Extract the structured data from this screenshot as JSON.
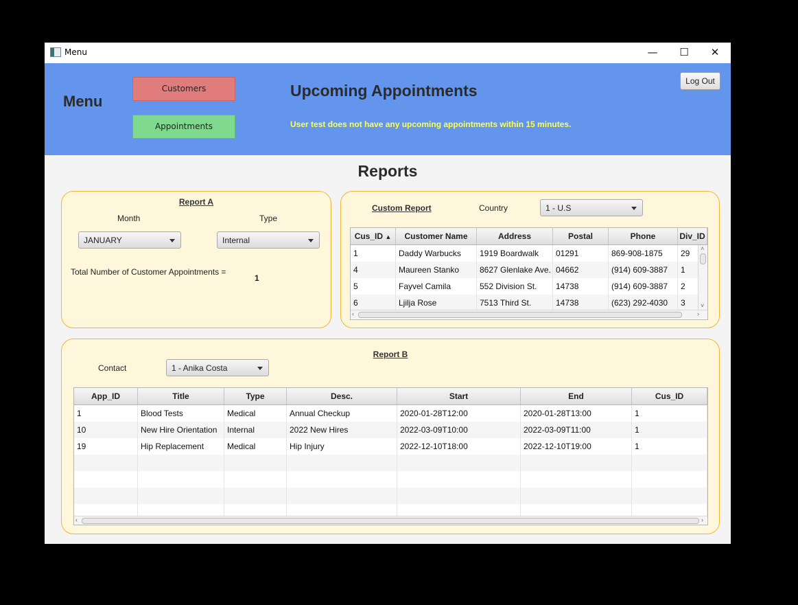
{
  "window": {
    "title": "Menu",
    "controls": {
      "minimize": "—",
      "maximize": "☐",
      "close": "✕"
    }
  },
  "header": {
    "menu_title": "Menu",
    "customers_button": "Customers",
    "appointments_button": "Appointments",
    "upcoming_title": "Upcoming Appointments",
    "upcoming_notice": "User test does not have any upcoming appointments within 15 minutes.",
    "logout_button": "Log Out",
    "colors": {
      "header_bg": "#6495ed",
      "customers_btn": "#e17c7c",
      "appointments_btn": "#7fd98f",
      "notice_text": "#ffff4d"
    }
  },
  "reports_title": "Reports",
  "report_a": {
    "title": "Report A",
    "month_label": "Month",
    "month_value": "JANUARY",
    "type_label": "Type",
    "type_value": "Internal",
    "total_label": "Total Number of Customer Appointments =",
    "total_value": "1"
  },
  "custom_report": {
    "title": "Custom Report",
    "country_label": "Country",
    "country_value": "1 - U.S",
    "sort_indicator": "▲",
    "columns": [
      "Cus_ID",
      "Customer Name",
      "Address",
      "Postal",
      "Phone",
      "Div_ID"
    ],
    "rows": [
      [
        "1",
        "Daddy Warbucks",
        "1919 Boardwalk",
        "01291",
        "869-908-1875",
        "29"
      ],
      [
        "4",
        "Maureen Stanko",
        "8627 Glenlake Ave.",
        "04662",
        "(914) 609-3887",
        "1"
      ],
      [
        "5",
        "Fayvel Camila",
        "552 Division St.",
        "14738",
        "(914) 609-3887",
        "2"
      ],
      [
        "6",
        "Ljilja Rose",
        "7513 Third St.",
        "14738",
        "(623) 292-4030",
        "3"
      ]
    ]
  },
  "report_b": {
    "title": "Report B",
    "contact_label": "Contact",
    "contact_value": "1 - Anika Costa",
    "columns": [
      "App_ID",
      "Title",
      "Type",
      "Desc.",
      "Start",
      "End",
      "Cus_ID"
    ],
    "rows": [
      [
        "1",
        "Blood Tests",
        "Medical",
        "Annual Checkup",
        "2020-01-28T12:00",
        "2020-01-28T13:00",
        "1"
      ],
      [
        "10",
        "New Hire Orientation",
        "Internal",
        "2022 New Hires",
        "2022-03-09T10:00",
        "2022-03-09T11:00",
        "1"
      ],
      [
        "19",
        "Hip Replacement",
        "Medical",
        "Hip Injury",
        "2022-12-10T18:00",
        "2022-12-10T19:00",
        "1"
      ]
    ],
    "empty_rows": 4
  },
  "colors": {
    "panel_bg": "#fff7dc",
    "panel_border": "#f2b632"
  }
}
